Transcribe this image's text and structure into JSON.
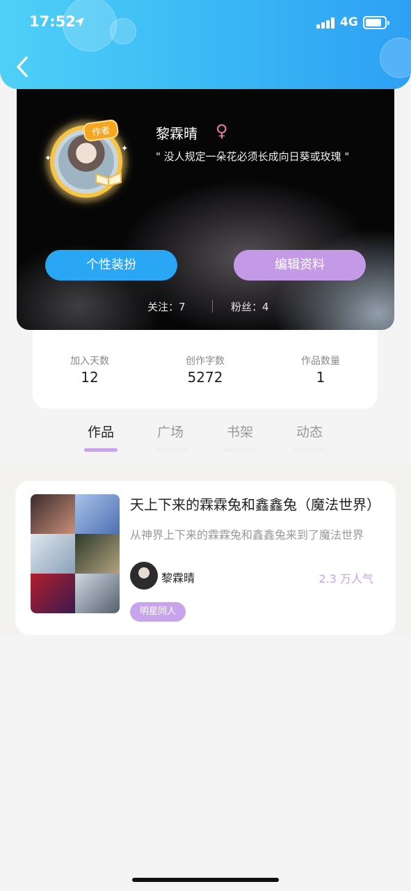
{
  "status_bar": {
    "time": "17:52",
    "network": "4G"
  },
  "profile": {
    "author_badge": "作者",
    "name": "黎霖晴",
    "gender_symbol": "♀",
    "motto": "\" 没人规定一朵花必须长成向日葵或玫瑰 \"",
    "buttons": {
      "outfit": "个性装扮",
      "edit": "编辑资料"
    },
    "follow": "关注：7",
    "fans": "粉丝：4"
  },
  "stats": [
    {
      "label": "加入天数",
      "value": "12"
    },
    {
      "label": "创作字数",
      "value": "5272"
    },
    {
      "label": "作品数量",
      "value": "1"
    }
  ],
  "tabs": [
    "作品",
    "广场",
    "书架",
    "动态"
  ],
  "work": {
    "title": "天上下来的霖霖兔和鑫鑫兔（魔法世界）",
    "description": "从神界上下来的霖霖兔和鑫鑫兔来到了魔法世界",
    "author": "黎霖晴",
    "popularity": "2.3 万人气",
    "tag": "明星同人"
  },
  "colors": {
    "header": "#3cbcf5",
    "accent_purple": "#c49ae6",
    "accent_blue": "#29a6f4"
  },
  "icons": [
    "back-arrow-icon",
    "location-arrow-icon",
    "signal-icon",
    "battery-icon",
    "female-icon"
  ]
}
